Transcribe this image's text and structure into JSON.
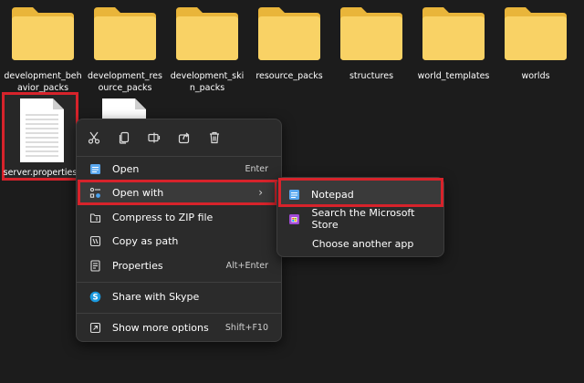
{
  "folders": [
    {
      "name": "development_behavior_packs"
    },
    {
      "name": "development_resource_packs"
    },
    {
      "name": "development_skin_packs"
    },
    {
      "name": "resource_packs"
    },
    {
      "name": "structures"
    },
    {
      "name": "world_templates"
    },
    {
      "name": "worlds"
    }
  ],
  "files": [
    {
      "name": "server.properties",
      "selected": true
    },
    {
      "name": "",
      "selected": false
    }
  ],
  "context_menu": {
    "quick_actions": [
      "cut-icon",
      "copy-icon",
      "rename-icon",
      "share-icon",
      "delete-icon"
    ],
    "items": [
      {
        "label": "Open",
        "shortcut": "Enter",
        "icon": "notepad-icon"
      },
      {
        "label": "Open with",
        "shortcut": "",
        "icon": "open-with-icon",
        "has_submenu": true
      },
      {
        "label": "Compress to ZIP file",
        "shortcut": "",
        "icon": "zip-icon"
      },
      {
        "label": "Copy as path",
        "shortcut": "",
        "icon": "copy-path-icon"
      },
      {
        "label": "Properties",
        "shortcut": "Alt+Enter",
        "icon": "properties-icon"
      },
      {
        "label": "Share with Skype",
        "shortcut": "",
        "icon": "skype-icon"
      },
      {
        "label": "Show more options",
        "shortcut": "Shift+F10",
        "icon": "more-options-icon"
      }
    ]
  },
  "submenu": {
    "items": [
      {
        "label": "Notepad",
        "icon": "notepad-icon"
      },
      {
        "label": "Search the Microsoft Store",
        "icon": "store-icon"
      },
      {
        "label": "Choose another app",
        "icon": ""
      }
    ]
  },
  "colors": {
    "background": "#1c1c1c",
    "menu": "#2b2b2b",
    "highlight_border": "#d7232b",
    "folder": "#f7c948",
    "accent": "#4aa3f0"
  }
}
